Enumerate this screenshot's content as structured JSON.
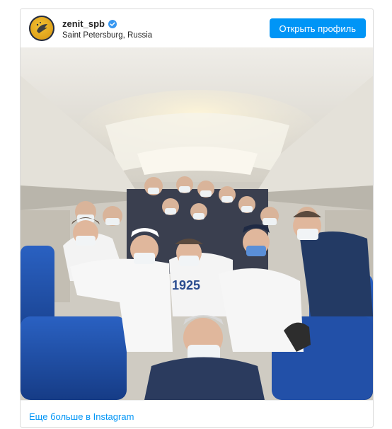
{
  "post": {
    "username": "zenit_spb",
    "location": "Saint Petersburg, Russia",
    "open_profile_label": "Открыть профиль",
    "more_link_label": "Еще больше в Instagram",
    "verified": true
  },
  "colors": {
    "accent": "#0095f6",
    "text": "#262626",
    "border": "#dbdbdb",
    "seat_blue": "#1d4fa8"
  },
  "icons": {
    "avatar": "zenit-logo-icon",
    "verified": "verified-badge-icon"
  },
  "photo": {
    "jersey_number": "1925"
  }
}
